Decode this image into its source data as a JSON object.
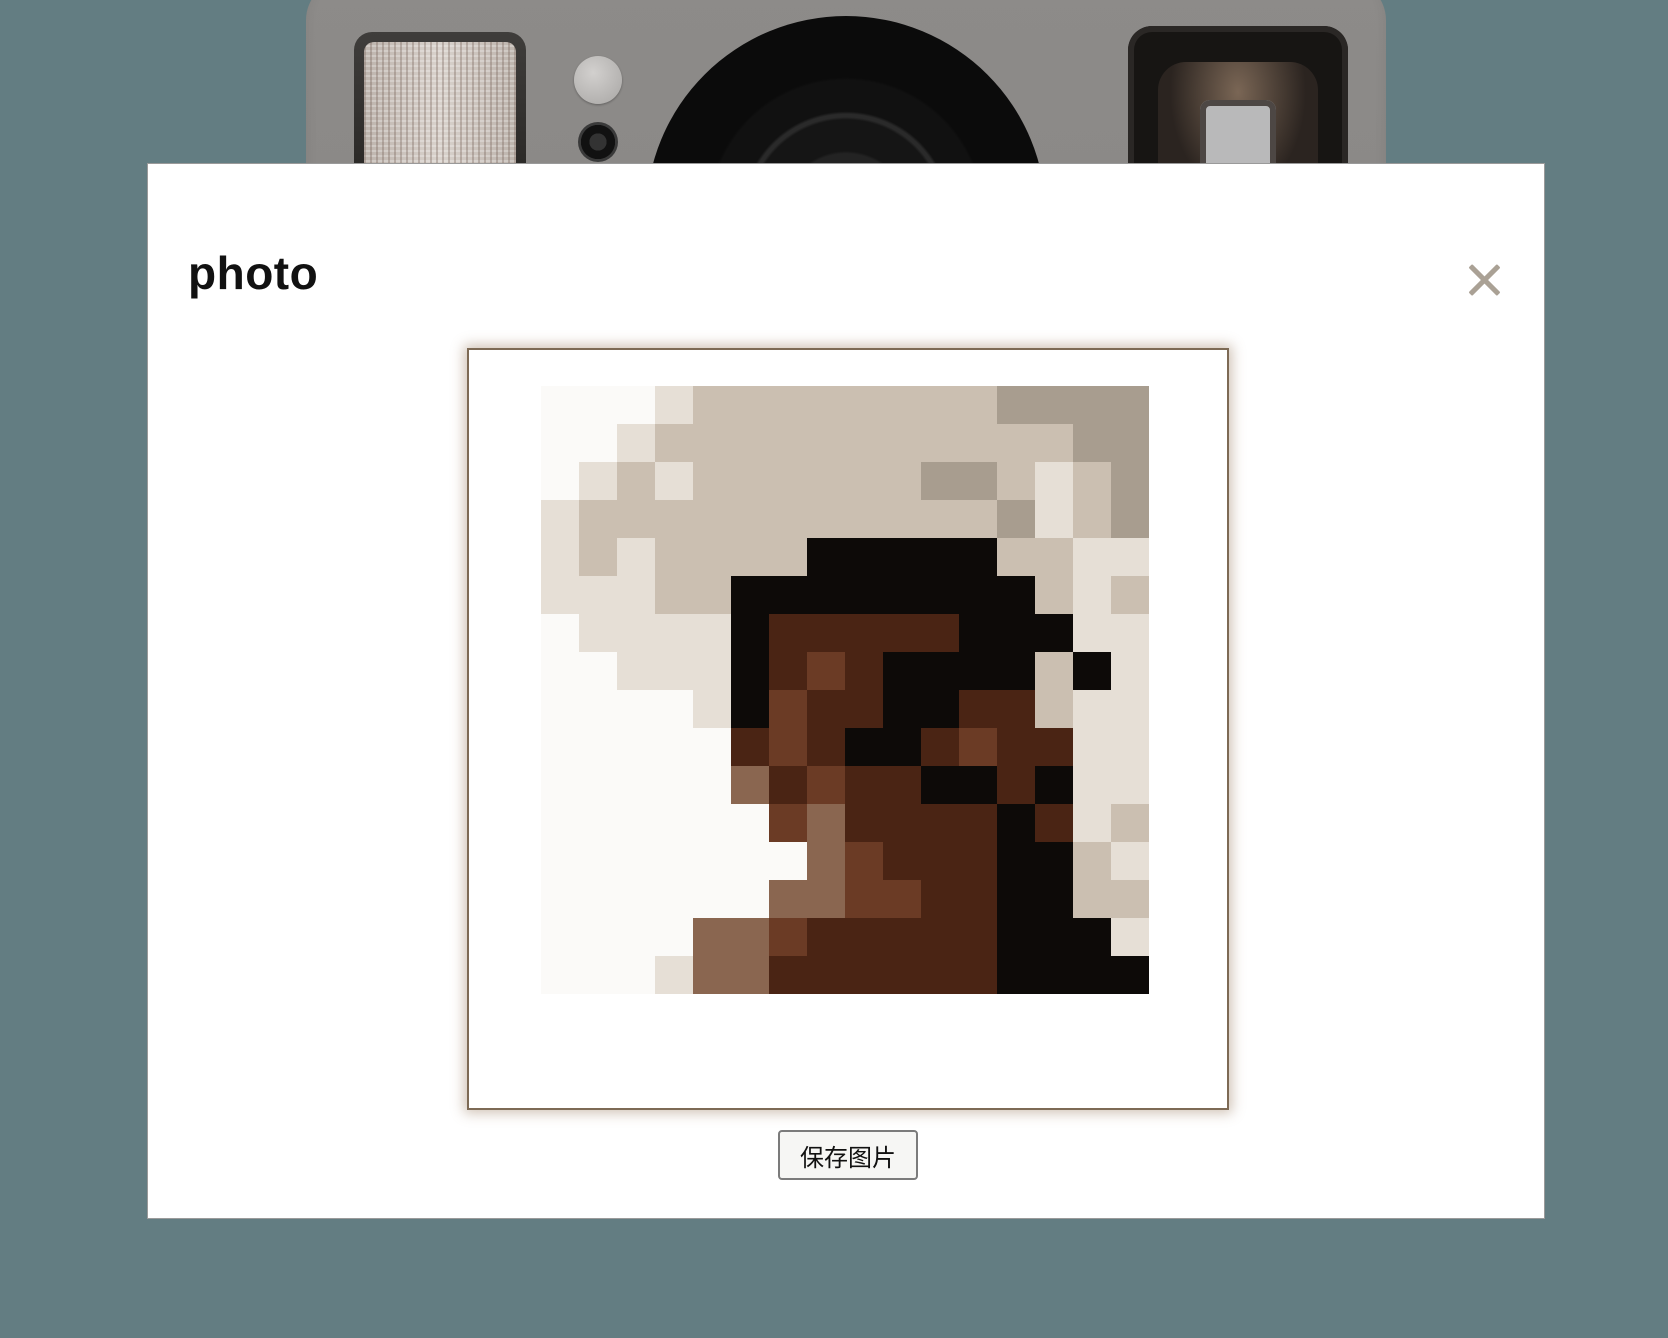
{
  "modal": {
    "title": "photo",
    "close_icon": "close-icon",
    "save_button_label": "保存图片"
  },
  "photo": {
    "description_icon": "pixelated-portrait-photo",
    "palette": {
      "w": "#fbfaf8",
      "l": "#e6dfd6",
      "t": "#cbbfb1",
      "m": "#a89d8f",
      "k": "#0d0a08",
      "r": "#4a2414",
      "b": "#6b3b25",
      "s": "#8a6650"
    },
    "rows": [
      "wwwlttttttttmmmm",
      "wwltttttttttttmm",
      "wltlttttttmmtltm",
      "ltttttttttttmltm",
      "ltlttttkkkkkttll",
      "lllttkkkkkkkktlt",
      "wllllkrrrrrkkkll",
      "wwlllkrbrkkkktkl",
      "wwwwlkbrrkkrrtll",
      "wwwwwrbrkkrbrrll",
      "wwwwwsrbrrkkrkll",
      "wwwwwwbsrrrrkrlt",
      "wwwwwwwsbrrrkktl",
      "wwwwwwssbbrrkktt",
      "wwwwssbrrrrrkkkl",
      "wwwlssrrrrrrkkkk"
    ]
  },
  "camera": {
    "flash_icon": "camera-flash-icon",
    "lens_icon": "camera-lens-icon",
    "viewfinder_icon": "camera-viewfinder-icon"
  }
}
